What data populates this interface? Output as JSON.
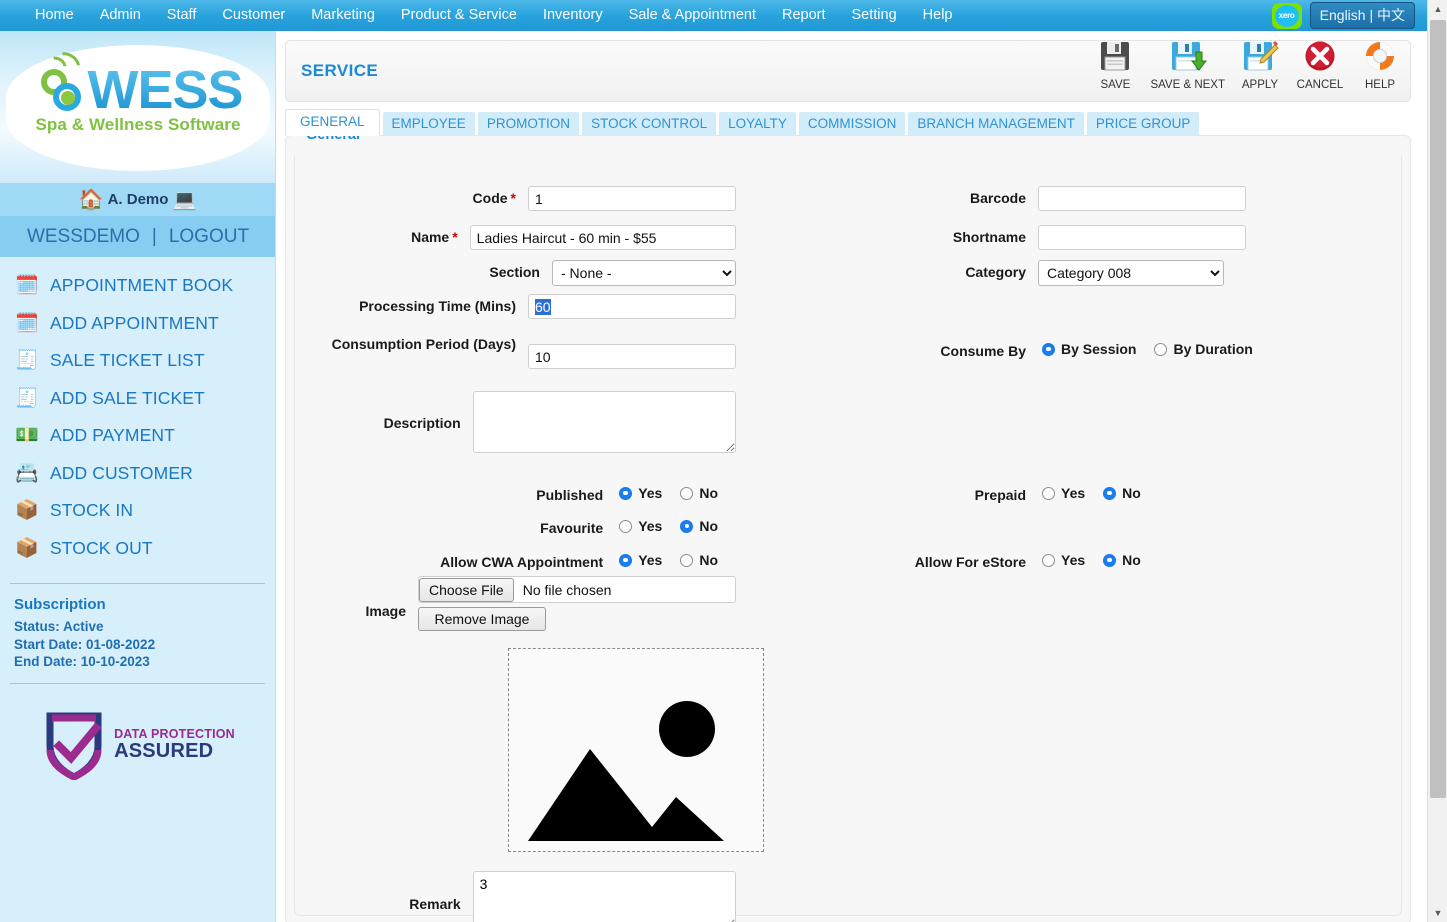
{
  "topnav": {
    "items": [
      {
        "label": "Home"
      },
      {
        "label": "Admin"
      },
      {
        "label": "Staff"
      },
      {
        "label": "Customer"
      },
      {
        "label": "Marketing"
      },
      {
        "label": "Product & Service"
      },
      {
        "label": "Inventory"
      },
      {
        "label": "Sale & Appointment"
      },
      {
        "label": "Report"
      },
      {
        "label": "Setting"
      },
      {
        "label": "Help"
      }
    ],
    "xero_label": "xero",
    "language_label": "English | 中文"
  },
  "sidebar": {
    "logo_text": "WESS",
    "logo_subtitle": "Spa & Wellness Software",
    "branch_name": "A. Demo",
    "branch_icon": "house-icon",
    "branch_device_icon": "laptop-icon",
    "account_name": "WESSDEMO",
    "account_separator": "|",
    "logout_label": "LOGOUT",
    "items": [
      {
        "label": "APPOINTMENT BOOK",
        "icon": "calendar-clock-icon"
      },
      {
        "label": "ADD APPOINTMENT",
        "icon": "calendar-clock-icon"
      },
      {
        "label": "SALE TICKET LIST",
        "icon": "receipt-icon"
      },
      {
        "label": "ADD SALE TICKET",
        "icon": "receipt-icon"
      },
      {
        "label": "ADD PAYMENT",
        "icon": "money-icon"
      },
      {
        "label": "ADD CUSTOMER",
        "icon": "id-card-icon"
      },
      {
        "label": "STOCK IN",
        "icon": "box-in-icon"
      },
      {
        "label": "STOCK OUT",
        "icon": "box-out-icon"
      }
    ],
    "subscription": {
      "title": "Subscription",
      "status": "Status: Active",
      "start_date": "Start Date: 01-08-2022",
      "end_date": "End Date: 10-10-2023"
    },
    "dpa": {
      "line1": "DATA PROTECTION",
      "line2": "ASSURED"
    }
  },
  "header": {
    "title": "SERVICE",
    "toolbar": [
      {
        "label": "SAVE",
        "icon": "floppy-disk-icon"
      },
      {
        "label": "SAVE & NEXT",
        "icon": "floppy-disk-down-arrow-icon"
      },
      {
        "label": "APPLY",
        "icon": "floppy-disk-pencil-icon"
      },
      {
        "label": "CANCEL",
        "icon": "red-x-circle-icon"
      },
      {
        "label": "HELP",
        "icon": "lifebuoy-icon"
      }
    ]
  },
  "tabs": [
    {
      "label": "GENERAL",
      "active": true
    },
    {
      "label": "EMPLOYEE",
      "active": false
    },
    {
      "label": "PROMOTION",
      "active": false
    },
    {
      "label": "STOCK CONTROL",
      "active": false
    },
    {
      "label": "LOYALTY",
      "active": false
    },
    {
      "label": "COMMISSION",
      "active": false
    },
    {
      "label": "BRANCH MANAGEMENT",
      "active": false
    },
    {
      "label": "PRICE GROUP",
      "active": false
    }
  ],
  "form": {
    "legend": "General",
    "code": {
      "label": "Code",
      "required": true,
      "value": "1"
    },
    "name": {
      "label": "Name",
      "required": true,
      "value": "Ladies Haircut - 60 min - $55"
    },
    "section": {
      "label": "Section",
      "value": "- None -",
      "options": [
        "- None -"
      ]
    },
    "processing_time": {
      "label": "Processing Time (Mins)",
      "value": "60",
      "selected": true
    },
    "consumption_period": {
      "label": "Consumption Period (Days)",
      "value": "10"
    },
    "description": {
      "label": "Description",
      "value": ""
    },
    "barcode": {
      "label": "Barcode",
      "value": ""
    },
    "shortname": {
      "label": "Shortname",
      "value": ""
    },
    "category": {
      "label": "Category",
      "value": "Category 008",
      "options": [
        "Category 008"
      ]
    },
    "consume_by": {
      "label": "Consume By",
      "options": [
        {
          "label": "By Session",
          "selected": true
        },
        {
          "label": "By Duration",
          "selected": false
        }
      ]
    },
    "published": {
      "label": "Published",
      "options": [
        {
          "label": "Yes",
          "selected": true
        },
        {
          "label": "No",
          "selected": false
        }
      ]
    },
    "favourite": {
      "label": "Favourite",
      "options": [
        {
          "label": "Yes",
          "selected": false
        },
        {
          "label": "No",
          "selected": true
        }
      ]
    },
    "allow_cwa": {
      "label": "Allow CWA Appointment",
      "options": [
        {
          "label": "Yes",
          "selected": true
        },
        {
          "label": "No",
          "selected": false
        }
      ]
    },
    "prepaid": {
      "label": "Prepaid",
      "options": [
        {
          "label": "Yes",
          "selected": false
        },
        {
          "label": "No",
          "selected": true
        }
      ]
    },
    "allow_estore": {
      "label": "Allow For eStore",
      "options": [
        {
          "label": "Yes",
          "selected": false
        },
        {
          "label": "No",
          "selected": true
        }
      ]
    },
    "image": {
      "label": "Image",
      "choose_file_label": "Choose File",
      "file_status": "No file chosen",
      "remove_label": "Remove Image",
      "preview_icon": "image-placeholder-icon"
    },
    "remark": {
      "label": "Remark",
      "value": "3"
    }
  },
  "scrollbar": {
    "up_icon": "triangle-up-icon",
    "down_icon": "triangle-down-icon"
  },
  "colors": {
    "nav_blue": "#29a3dd",
    "sidebar_blue": "#d7eefb",
    "link_blue": "#1a78c2",
    "accent": "#1a8ad4",
    "required_red": "#d40000",
    "radio_on": "#1a7ef0"
  }
}
